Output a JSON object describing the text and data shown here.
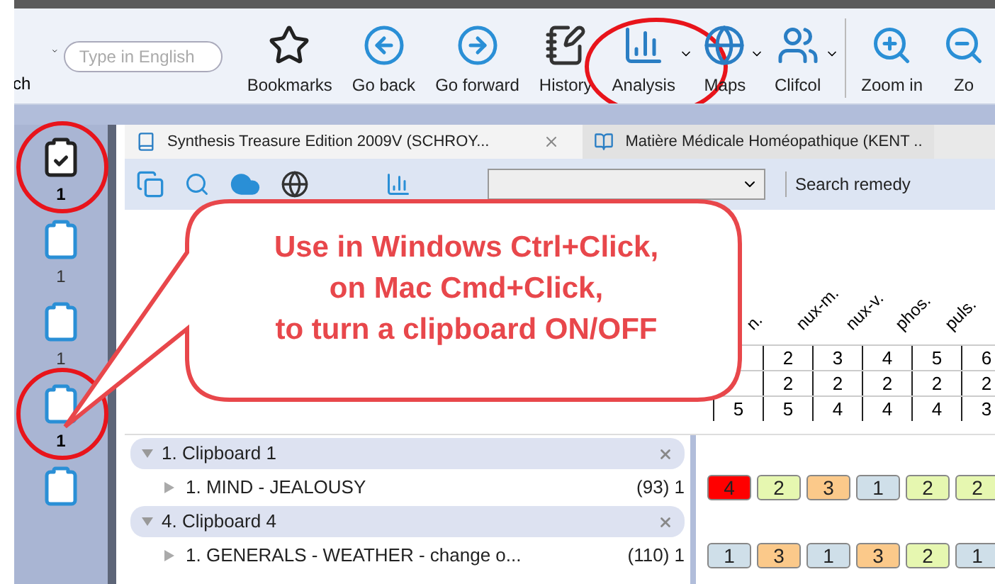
{
  "toolbar": {
    "cut_label": "ch",
    "search": {
      "placeholder": "Type in English"
    },
    "buttons": [
      {
        "label": "Bookmarks",
        "kind": "star",
        "dropdown": false,
        "highlighted": false
      },
      {
        "label": "Go back",
        "kind": "back",
        "dropdown": false,
        "highlighted": false
      },
      {
        "label": "Go forward",
        "kind": "forward",
        "dropdown": false,
        "highlighted": false
      },
      {
        "label": "History",
        "kind": "history",
        "dropdown": false,
        "highlighted": false
      },
      {
        "label": "Analysis",
        "kind": "analysis",
        "dropdown": true,
        "highlighted": true
      },
      {
        "label": "Maps",
        "kind": "maps",
        "dropdown": true,
        "highlighted": false
      },
      {
        "label": "Clifcol",
        "kind": "people",
        "dropdown": true,
        "highlighted": false
      },
      {
        "label": "Zoom in",
        "kind": "zoom",
        "dropdown": false,
        "highlighted": false
      },
      {
        "label": "Zo",
        "kind": "zoomout",
        "dropdown": false,
        "highlighted": false
      }
    ]
  },
  "clipboards": [
    {
      "checked": true,
      "selected": true,
      "count": "1"
    },
    {
      "checked": false,
      "selected": false,
      "count": "1"
    },
    {
      "checked": false,
      "selected": false,
      "count": "1"
    },
    {
      "checked": false,
      "selected": true,
      "count": "1"
    },
    {
      "checked": false,
      "selected": false
    }
  ],
  "tabs": [
    {
      "title": "Synthesis Treasure Edition 2009V (SCHROY...",
      "selected": true
    },
    {
      "title": "Matière Médicale Homéopathique (KENT ..",
      "selected": false
    }
  ],
  "search_remedy": "Search remedy",
  "callout": [
    "Use in Windows Ctrl+Click,",
    "on Mac Cmd+Click,",
    "to turn a clipboard ON/OFF"
  ],
  "remedy_columns": [
    "n.",
    "nux-m.",
    "nux-v.",
    "phos.",
    "puls."
  ],
  "summary_rows": [
    [
      "2",
      "3",
      "4",
      "5",
      "6"
    ],
    [
      "2",
      "2",
      "2",
      "2",
      "2"
    ],
    [
      "5",
      "5",
      "4",
      "4",
      "4",
      "3"
    ]
  ],
  "clipboard_tree": [
    {
      "title": "1. Clipboard 1",
      "expanded": true,
      "children": [
        {
          "title": "1. MIND - JEALOUSY",
          "count": "(93) 1",
          "grades": [
            {
              "value": "4",
              "color": "#ff0000"
            },
            {
              "value": "2",
              "color": "#e6f7b0"
            },
            {
              "value": "3",
              "color": "#fbc98a"
            },
            {
              "value": "1",
              "color": "#cfdfe9"
            },
            {
              "value": "2",
              "color": "#e6f7b0"
            },
            {
              "value": "2",
              "color": "#e6f7b0"
            }
          ]
        }
      ]
    },
    {
      "title": "4. Clipboard 4",
      "expanded": true,
      "children": [
        {
          "title": "1. GENERALS - WEATHER - change o...",
          "count": "(110) 1",
          "grades": [
            {
              "value": "1",
              "color": "#cfdfe9"
            },
            {
              "value": "3",
              "color": "#fbc98a"
            },
            {
              "value": "1",
              "color": "#cfdfe9"
            },
            {
              "value": "3",
              "color": "#fbc98a"
            },
            {
              "value": "2",
              "color": "#e6f7b0"
            },
            {
              "value": "1",
              "color": "#cfdfe9"
            }
          ]
        }
      ]
    }
  ]
}
